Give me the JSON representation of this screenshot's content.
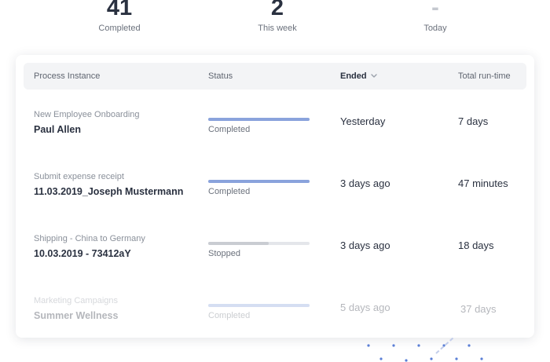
{
  "stats": [
    {
      "value": "41",
      "label": "Completed"
    },
    {
      "value": "2",
      "label": "This week"
    },
    {
      "value": "-",
      "label": "Today"
    }
  ],
  "table": {
    "columns": [
      "Process Instance",
      "Status",
      "Ended",
      "Total run-time"
    ],
    "sorted_column": "Ended",
    "rows": [
      {
        "category": "New Employee Onboarding",
        "name": "Paul Allen",
        "status": "Completed",
        "progress": 1.0,
        "bar_color": "#8aa3dc",
        "ended": "Yesterday",
        "runtime": "7 days"
      },
      {
        "category": "Submit expense receipt",
        "name": "11.03.2019_Joseph Mustermann",
        "status": "Completed",
        "progress": 1.0,
        "bar_color": "#8aa3dc",
        "ended": "3 days ago",
        "runtime": "47 minutes"
      },
      {
        "category": "Shipping - China to Germany",
        "name": "10.03.2019 - 73412aY",
        "status": "Stopped",
        "progress": 0.6,
        "bar_color": "#c9ccd2",
        "ended": "3 days ago",
        "runtime": "18 days"
      },
      {
        "category": "Marketing Campaigns",
        "name": "Summer Wellness",
        "status": "Completed",
        "progress": 1.0,
        "bar_color": "#8aa3dc",
        "ended": "5 days ago",
        "runtime": "37 days"
      }
    ]
  },
  "colors": {
    "accent": "#8aa3dc",
    "stopped_bar": "#c9ccd2",
    "text_dark": "#2a3140",
    "header_bg": "#f3f4f6",
    "decor_dots": "#5b7fd6"
  },
  "icons": {
    "sort": "chevron-down-icon",
    "decoration": "dot-grid-decoration"
  }
}
